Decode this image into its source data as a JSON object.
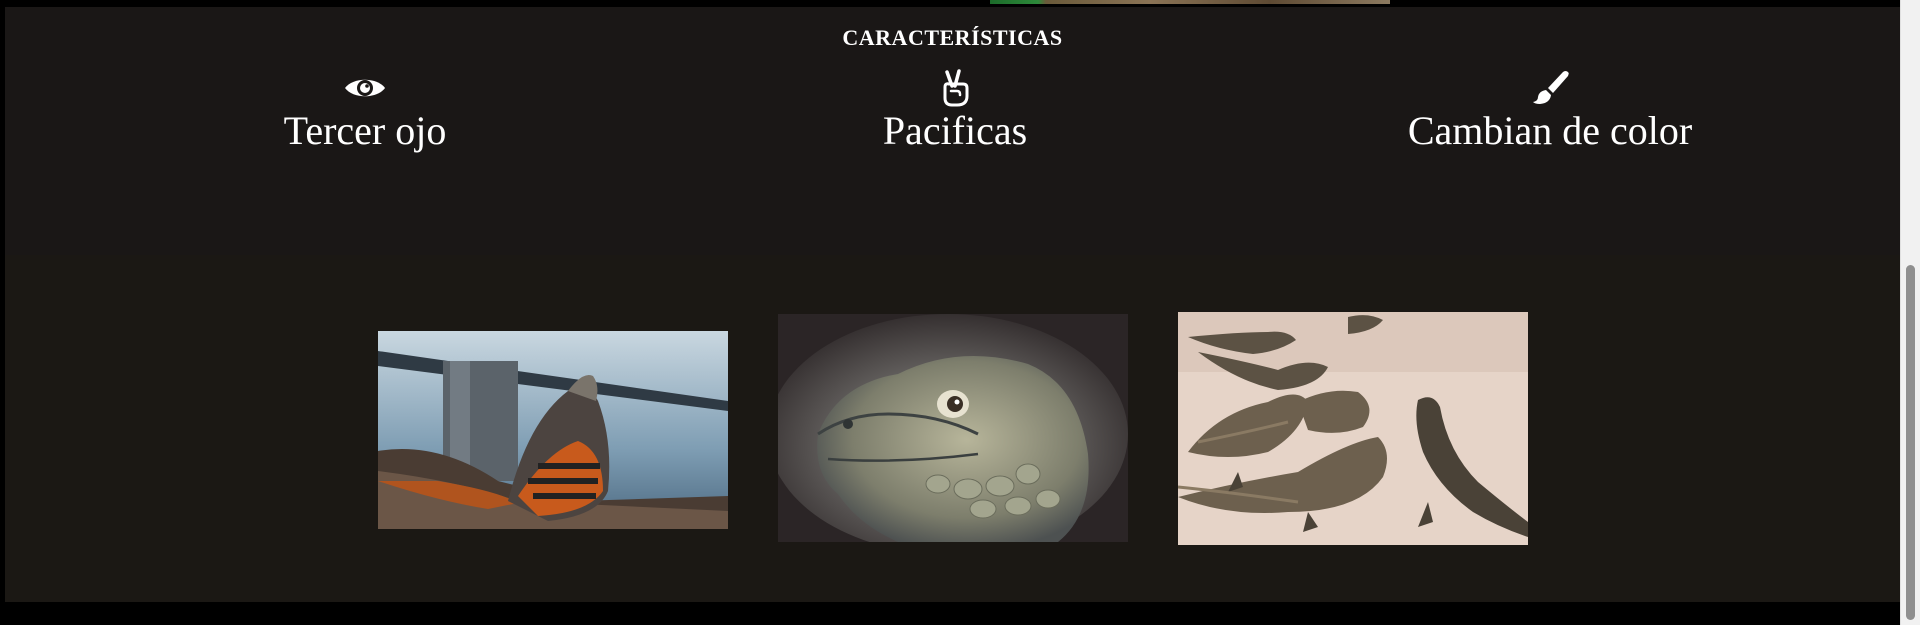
{
  "features": {
    "title": "CARACTERÍSTICAS",
    "items": [
      {
        "icon": "eye-icon",
        "label": "Tercer ojo"
      },
      {
        "icon": "peace-hand-icon",
        "label": "Pacificas"
      },
      {
        "icon": "paint-brush-icon",
        "label": "Cambian de color"
      }
    ]
  },
  "gallery": {
    "images": [
      {
        "subject": "orange iguana by the water"
      },
      {
        "subject": "iguana head close-up"
      },
      {
        "subject": "group of iguanas on sand"
      }
    ]
  },
  "colors": {
    "features_background": "#1a1716",
    "gallery_background": "#1b1814",
    "text": "#ffffff"
  }
}
